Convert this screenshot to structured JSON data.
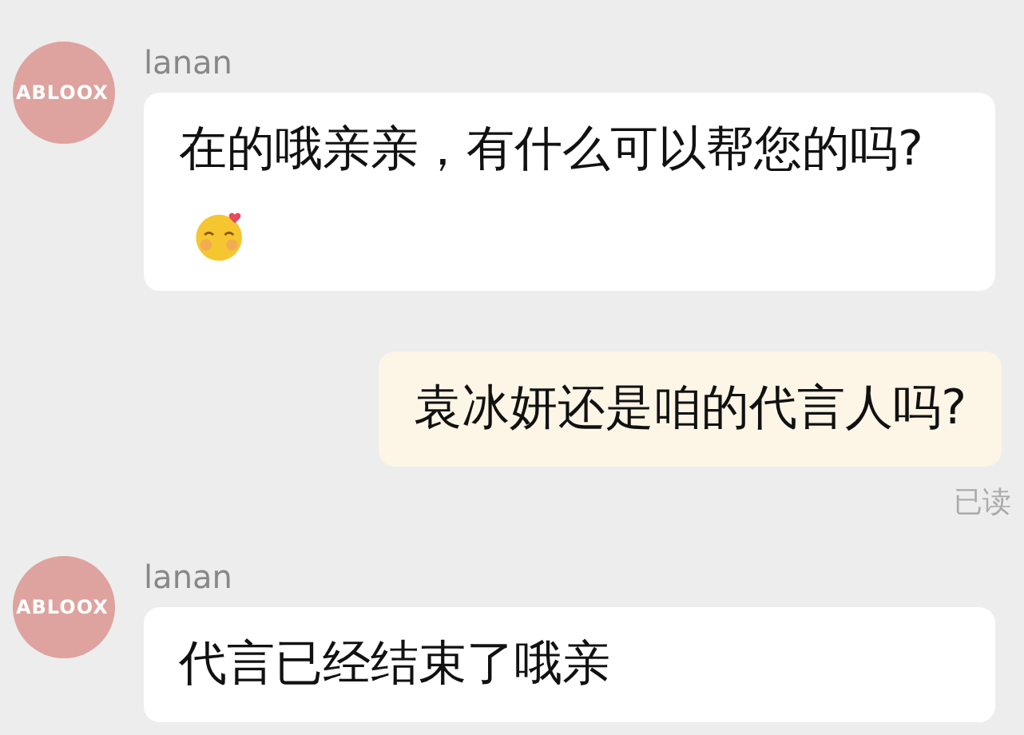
{
  "messages": [
    {
      "kind": "incoming",
      "sender": "lanan",
      "avatar_text": "ABLOOX",
      "text": "在的哦亲亲，有什么可以帮您的吗?",
      "emoji": true
    },
    {
      "kind": "outgoing",
      "text": "袁冰妍还是咱的代言人吗?",
      "receipt": "已读",
      "emoji": false
    },
    {
      "kind": "incoming",
      "sender": "lanan",
      "avatar_text": "ABLOOX",
      "text": "代言已经结束了哦亲",
      "emoji": false
    }
  ]
}
